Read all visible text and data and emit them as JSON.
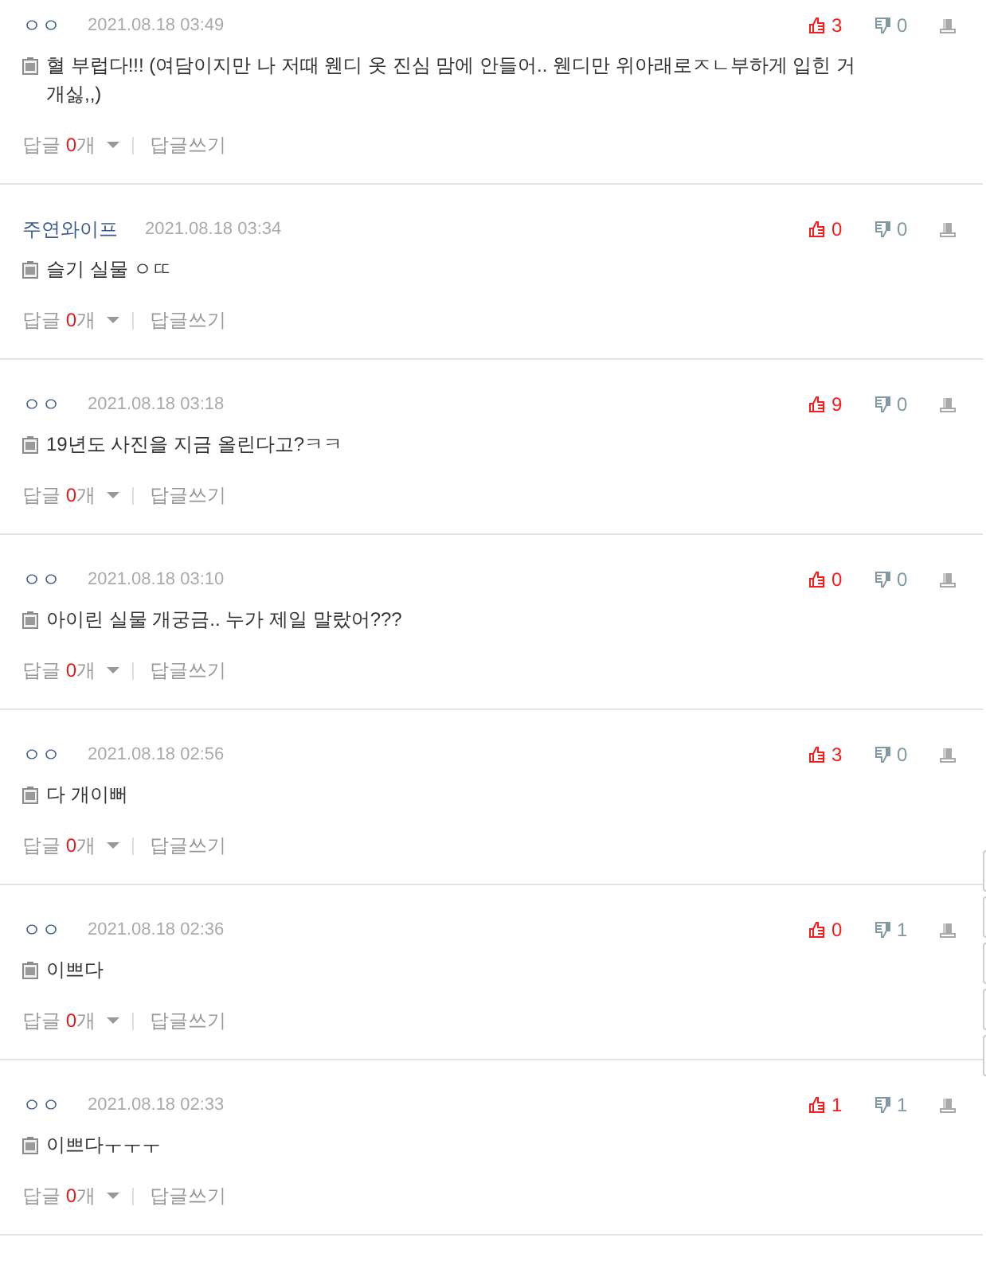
{
  "comments": [
    {
      "author": "ㅇㅇ",
      "date": "2021.08.18 03:49",
      "likes": "3",
      "dislikes": "0",
      "body": "혈 부럽다!!! (여담이지만 나 저때 웬디 옷 진심 맘에 안들어.. 웬디만 위아래로ㅈㄴ부하게 입힌 거 개싫,,)",
      "replies": {
        "label": "답글",
        "count": "0",
        "unit": "개"
      },
      "write_reply": "답글쓰기"
    },
    {
      "author": "주연와이프",
      "date": "2021.08.18 03:34",
      "likes": "0",
      "dislikes": "0",
      "body": "슬기 실물 ㅇㄸ",
      "replies": {
        "label": "답글",
        "count": "0",
        "unit": "개"
      },
      "write_reply": "답글쓰기"
    },
    {
      "author": "ㅇㅇ",
      "date": "2021.08.18 03:18",
      "likes": "9",
      "dislikes": "0",
      "body": "19년도 사진을 지금 올린다고?ㅋㅋ",
      "replies": {
        "label": "답글",
        "count": "0",
        "unit": "개"
      },
      "write_reply": "답글쓰기"
    },
    {
      "author": "ㅇㅇ",
      "date": "2021.08.18 03:10",
      "likes": "0",
      "dislikes": "0",
      "body": "아이린 실물 개궁금.. 누가 제일 말랐어???",
      "replies": {
        "label": "답글",
        "count": "0",
        "unit": "개"
      },
      "write_reply": "답글쓰기"
    },
    {
      "author": "ㅇㅇ",
      "date": "2021.08.18 02:56",
      "likes": "3",
      "dislikes": "0",
      "body": "다 개이뻐",
      "replies": {
        "label": "답글",
        "count": "0",
        "unit": "개"
      },
      "write_reply": "답글쓰기"
    },
    {
      "author": "ㅇㅇ",
      "date": "2021.08.18 02:36",
      "likes": "0",
      "dislikes": "1",
      "body": "이쁘다",
      "replies": {
        "label": "답글",
        "count": "0",
        "unit": "개"
      },
      "write_reply": "답글쓰기"
    },
    {
      "author": "ㅇㅇ",
      "date": "2021.08.18 02:33",
      "likes": "1",
      "dislikes": "1",
      "body": "이쁘다ㅜㅜㅜ",
      "replies": {
        "label": "답글",
        "count": "0",
        "unit": "개"
      },
      "write_reply": "답글쓰기"
    }
  ]
}
